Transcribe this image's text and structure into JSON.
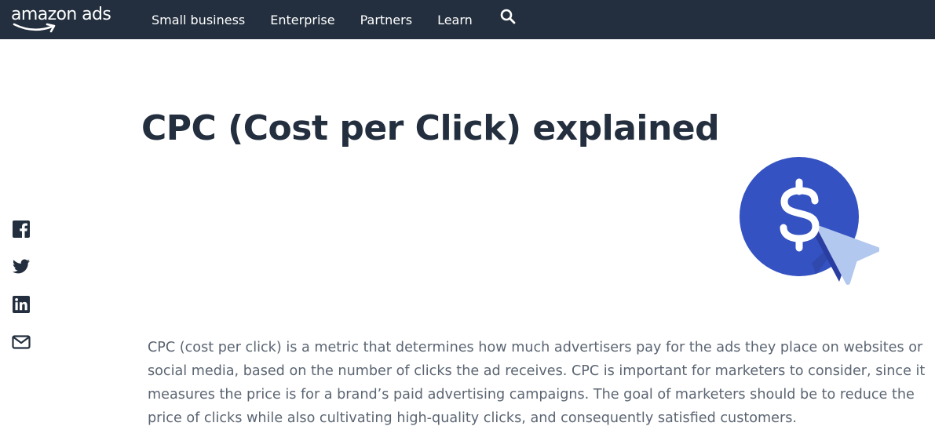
{
  "nav": {
    "logo_text": "amazon ads",
    "links": [
      "Small business",
      "Enterprise",
      "Partners",
      "Learn"
    ],
    "search_icon": "search-icon",
    "background": "#232f3e"
  },
  "share": {
    "icons": [
      "facebook-icon",
      "twitter-icon",
      "linkedin-icon",
      "email-icon"
    ]
  },
  "article": {
    "title": "CPC (Cost per Click) explained",
    "intro": "CPC (cost per click) is a metric that determines how much advertisers pay for the ads they place on websites or social media, based on the number of clicks the ad receives. CPC is important for marketers to consider, since it measures the price is for a brand’s paid advertising campaigns. The goal of marketers should be to reduce the price of clicks while also cultivating high-quality clicks, and consequently satisfied customers."
  },
  "hero": {
    "icon": "dollar-cursor-icon",
    "circle_color": "#3452c1",
    "cursor_color": "#b3c8ee"
  }
}
